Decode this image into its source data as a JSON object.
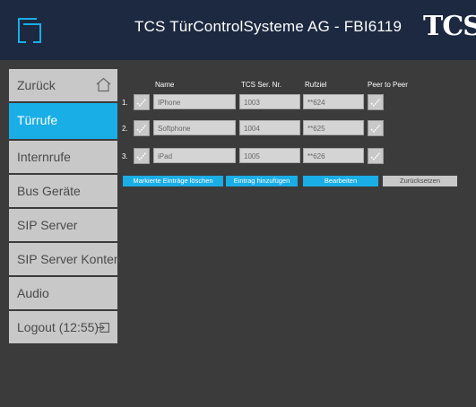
{
  "header": {
    "title": "TCS TürControlSysteme AG - FBI6119",
    "brand": "TCS"
  },
  "sidebar": {
    "items": [
      {
        "label": "Zurück"
      },
      {
        "label": "Türrufe"
      },
      {
        "label": "Internrufe"
      },
      {
        "label": "Bus Geräte"
      },
      {
        "label": "SIP Server"
      },
      {
        "label": "SIP Server Konten"
      },
      {
        "label": "Audio"
      },
      {
        "label": "Logout (12:55)"
      }
    ]
  },
  "table": {
    "columns": {
      "name": "Name",
      "serial": "TCS Ser. Nr.",
      "target": "Rufziel",
      "p2p": "Peer to Peer"
    },
    "rows": [
      {
        "num": "1.",
        "name": "IPhone",
        "serial": "1003",
        "target": "**624"
      },
      {
        "num": "2.",
        "name": "Softphone",
        "serial": "1004",
        "target": "**625"
      },
      {
        "num": "3.",
        "name": "iPad",
        "serial": "1005",
        "target": "**626"
      }
    ]
  },
  "actions": {
    "delete": "Markierte Einträge löschen",
    "add": "Eintrag hinzufügen",
    "edit": "Bearbeiten",
    "reset": "Zurücksetzen"
  },
  "colors": {
    "header_bg": "#1c2940",
    "accent": "#1aaee6",
    "nav_bg": "#c8c8c8",
    "page_bg": "#3b3b3b"
  }
}
